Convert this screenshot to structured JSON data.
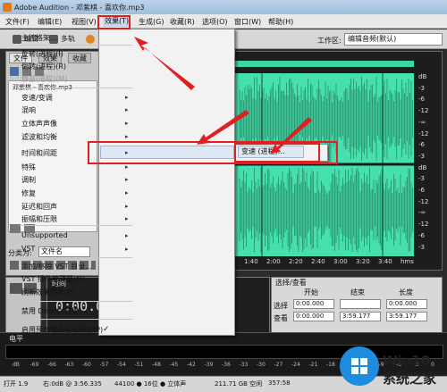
{
  "window": {
    "title": "Adobe Audition - 邓紫棋 - 喜欢你.mp3"
  },
  "menubar": [
    {
      "label": "文件(F)"
    },
    {
      "label": "编辑(E)"
    },
    {
      "label": "视图(V)"
    },
    {
      "label": "效果(T)"
    },
    {
      "label": "生成(G)"
    },
    {
      "label": "收藏(R)"
    },
    {
      "label": "选项(O)"
    },
    {
      "label": "窗口(W)"
    },
    {
      "label": "帮助(H)"
    }
  ],
  "toolbar": {
    "edit_label": "编辑",
    "multitrack_label": "多轨",
    "workspace_label": "工作区:",
    "workspace_value": "编辑音频(默认)"
  },
  "left_panel": {
    "tabs": [
      {
        "label": "文件"
      },
      {
        "label": "效果"
      },
      {
        "label": "收藏"
      }
    ],
    "file_item": "邓紫棋 - 喜欢你.mp3",
    "sort_label": "分类为:",
    "sort_value": "文件名"
  },
  "effects_menu": {
    "items": [
      {
        "label": "主控格架...",
        "dim": false,
        "sub": false
      },
      {
        "label": "反转(进程)(I)",
        "dim": false,
        "sub": false
      },
      {
        "label": "倒转(进程)(R)",
        "dim": false,
        "sub": false
      },
      {
        "label": "静音(进程)(M)",
        "dim": true,
        "sub": false
      },
      {
        "label": "变速/变调",
        "dim": false,
        "sub": true
      },
      {
        "label": "混响",
        "dim": false,
        "sub": true
      },
      {
        "label": "立体声声像",
        "dim": false,
        "sub": true
      },
      {
        "label": "滤波和均衡",
        "dim": false,
        "sub": true
      },
      {
        "label": "时间和间距",
        "dim": false,
        "sub": true
      },
      {
        "label": "特殊",
        "dim": false,
        "sub": true
      },
      {
        "label": "调制",
        "dim": false,
        "sub": true
      },
      {
        "label": "修复",
        "dim": false,
        "sub": true
      },
      {
        "label": "延迟和回声",
        "dim": false,
        "sub": true
      },
      {
        "label": "振幅和压限",
        "dim": false,
        "sub": true
      },
      {
        "label": "Unsupported",
        "dim": false,
        "sub": true
      },
      {
        "label": "VST",
        "dim": false,
        "sub": true
      },
      {
        "label": "添加/移除 VST 目录...",
        "dim": false,
        "sub": false
      },
      {
        "label": "VST 插件管理器(M)...",
        "dim": false,
        "sub": false
      },
      {
        "label": "刷新效果列表(F)",
        "dim": false,
        "sub": false
      },
      {
        "label": "禁用 DirectX效果",
        "dim": false,
        "sub": false
      },
      {
        "label": "启用预加载及延迟预览(P)",
        "dim": false,
        "sub": false
      }
    ],
    "submenu_item": "变速 (进程)..."
  },
  "db_scale": [
    "dB",
    "-3",
    "-6",
    "-12",
    "-∞",
    "-12",
    "-6",
    "-3",
    "dB",
    "-3",
    "-6",
    "-12",
    "-∞",
    "-12",
    "-6",
    "-3"
  ],
  "time_ruler": [
    "1:40",
    "2:00",
    "2:20",
    "2:40",
    "3:00",
    "3:20",
    "3:40",
    "hms"
  ],
  "time_panel": {
    "tab": "时间",
    "value": "0:00.000"
  },
  "selection_panel": {
    "title": "选择/查看",
    "headers": [
      "开始",
      "结束",
      "长度"
    ],
    "rows": [
      {
        "label": "选择",
        "start": "0:00.000",
        "end": "",
        "length": "0:00.000"
      },
      {
        "label": "查看",
        "start": "0:00.000",
        "end": "3:59.177",
        "length": "3:59.177"
      }
    ]
  },
  "level_panel": {
    "tab": "电平",
    "scale": [
      "dB",
      "-69",
      "-66",
      "-63",
      "-60",
      "-57",
      "-54",
      "-51",
      "-48",
      "-45",
      "-42",
      "-39",
      "-36",
      "-33",
      "-30",
      "-27",
      "-24",
      "-21",
      "-18",
      "-15",
      "-12",
      "-9",
      "-6",
      "-3",
      "0"
    ]
  },
  "status_bar": {
    "items": [
      "打开 1.9",
      "右:0dB @ 3:56.335",
      "44100 ● 16位 ● 立体声",
      "211.71 GB 空闲",
      "357:58"
    ]
  },
  "watermark": {
    "brand": "Win10 系统之家",
    "url": "www.qdhuajin.com"
  },
  "colors": {
    "wave": "#46e0ae",
    "menu_highlight": "#dfe9f5",
    "annotation_red": "#e02020"
  }
}
